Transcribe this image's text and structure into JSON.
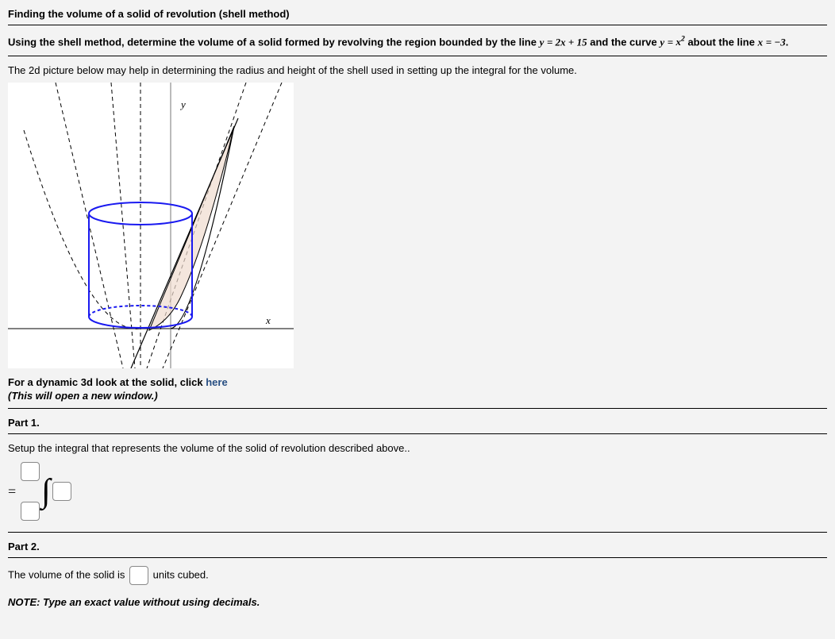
{
  "title": "Finding the volume of a solid of revolution (shell method)",
  "problem": {
    "prefix": "Using the shell method, determine the volume of a solid formed by revolving the region bounded by the line ",
    "eq1_lhs": "y",
    "eq1_rhs": "2x + 15",
    "mid1": " and the curve ",
    "eq2_lhs": "y",
    "eq2_rhs_base": "x",
    "eq2_rhs_exp": "2",
    "mid2": " about the line ",
    "eq3_lhs": "x",
    "eq3_rhs": "−3",
    "suffix": "."
  },
  "hint": "The 2d picture below may help in determining the radius and height of the shell used in setting up the integral for the volume.",
  "figure_labels": {
    "y": "y",
    "x": "x"
  },
  "link_line": {
    "prefix": "For a dynamic 3d look at the solid, click ",
    "link": "here"
  },
  "link_note": "(This will open a new window.)",
  "part1": {
    "label": "Part 1.",
    "instruction": "Setup the integral that represents the volume of the solid of revolution described above..",
    "equals": "="
  },
  "part2": {
    "label": "Part 2.",
    "sentence_prefix": "The volume of the solid is ",
    "sentence_suffix": " units cubed."
  },
  "note": "NOTE: Type an exact value without using decimals."
}
